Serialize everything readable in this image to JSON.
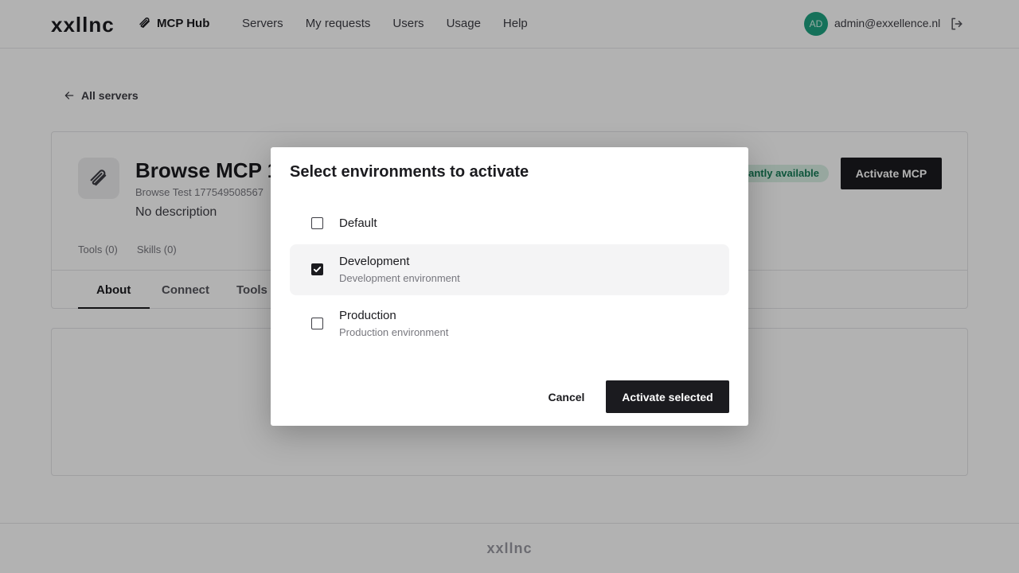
{
  "header": {
    "logo": "xxllnc",
    "hub_label": "MCP Hub",
    "nav": [
      "Servers",
      "My requests",
      "Users",
      "Usage",
      "Help"
    ],
    "avatar_initials": "AD",
    "user_email": "admin@exxellence.nl"
  },
  "page": {
    "back_label": "All servers",
    "server_title": "Browse MCP 17",
    "server_subtitle": "Browse Test 177549508567",
    "server_description": "No description",
    "status_badge": "Instantly available",
    "activate_label": "Activate MCP",
    "counts": [
      "Tools (0)",
      "Skills (0)"
    ],
    "tabs": [
      "About",
      "Connect",
      "Tools (0)"
    ]
  },
  "footer": {
    "logo": "xxllnc"
  },
  "modal": {
    "title": "Select environments to activate",
    "options": [
      {
        "name": "Default",
        "description": "",
        "checked": false
      },
      {
        "name": "Development",
        "description": "Development environment",
        "checked": true
      },
      {
        "name": "Production",
        "description": "Production environment",
        "checked": false
      }
    ],
    "cancel_label": "Cancel",
    "confirm_label": "Activate selected"
  },
  "colors": {
    "primary": "#1b1b1f",
    "avatar": "#1fa382",
    "badge_bg": "#d9efe4",
    "badge_text": "#147a55"
  }
}
